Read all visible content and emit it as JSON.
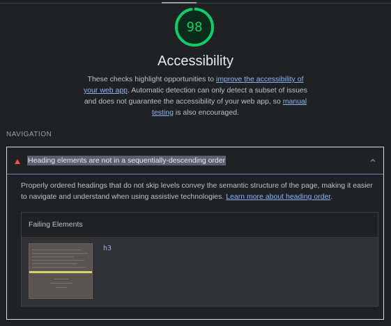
{
  "category": {
    "score": "98",
    "score_fraction": 0.98,
    "score_color": "#0cce6b",
    "title": "Accessibility",
    "description": {
      "p1": "These checks highlight opportunities to ",
      "link1": "improve the accessibility of your web app",
      "p2": ". Automatic detection can only detect a subset of issues and does not guarantee the accessibility of your web app, so ",
      "link2": "manual testing",
      "p3": " is also encouraged."
    }
  },
  "group": {
    "title": "NAVIGATION"
  },
  "audit": {
    "status_icon": "fail-triangle-icon",
    "status_color": "#ff4e42",
    "title": "Heading elements are not in a sequentially-descending order",
    "description": "Properly ordered headings that do not skip levels convey the semantic structure of the page, making it easier to navigate and understand when using assistive technologies. ",
    "learn_more": "Learn more about heading order",
    "learn_more_suffix": ".",
    "details": {
      "header": "Failing Elements",
      "items": [
        {
          "node": "h3"
        }
      ]
    }
  }
}
